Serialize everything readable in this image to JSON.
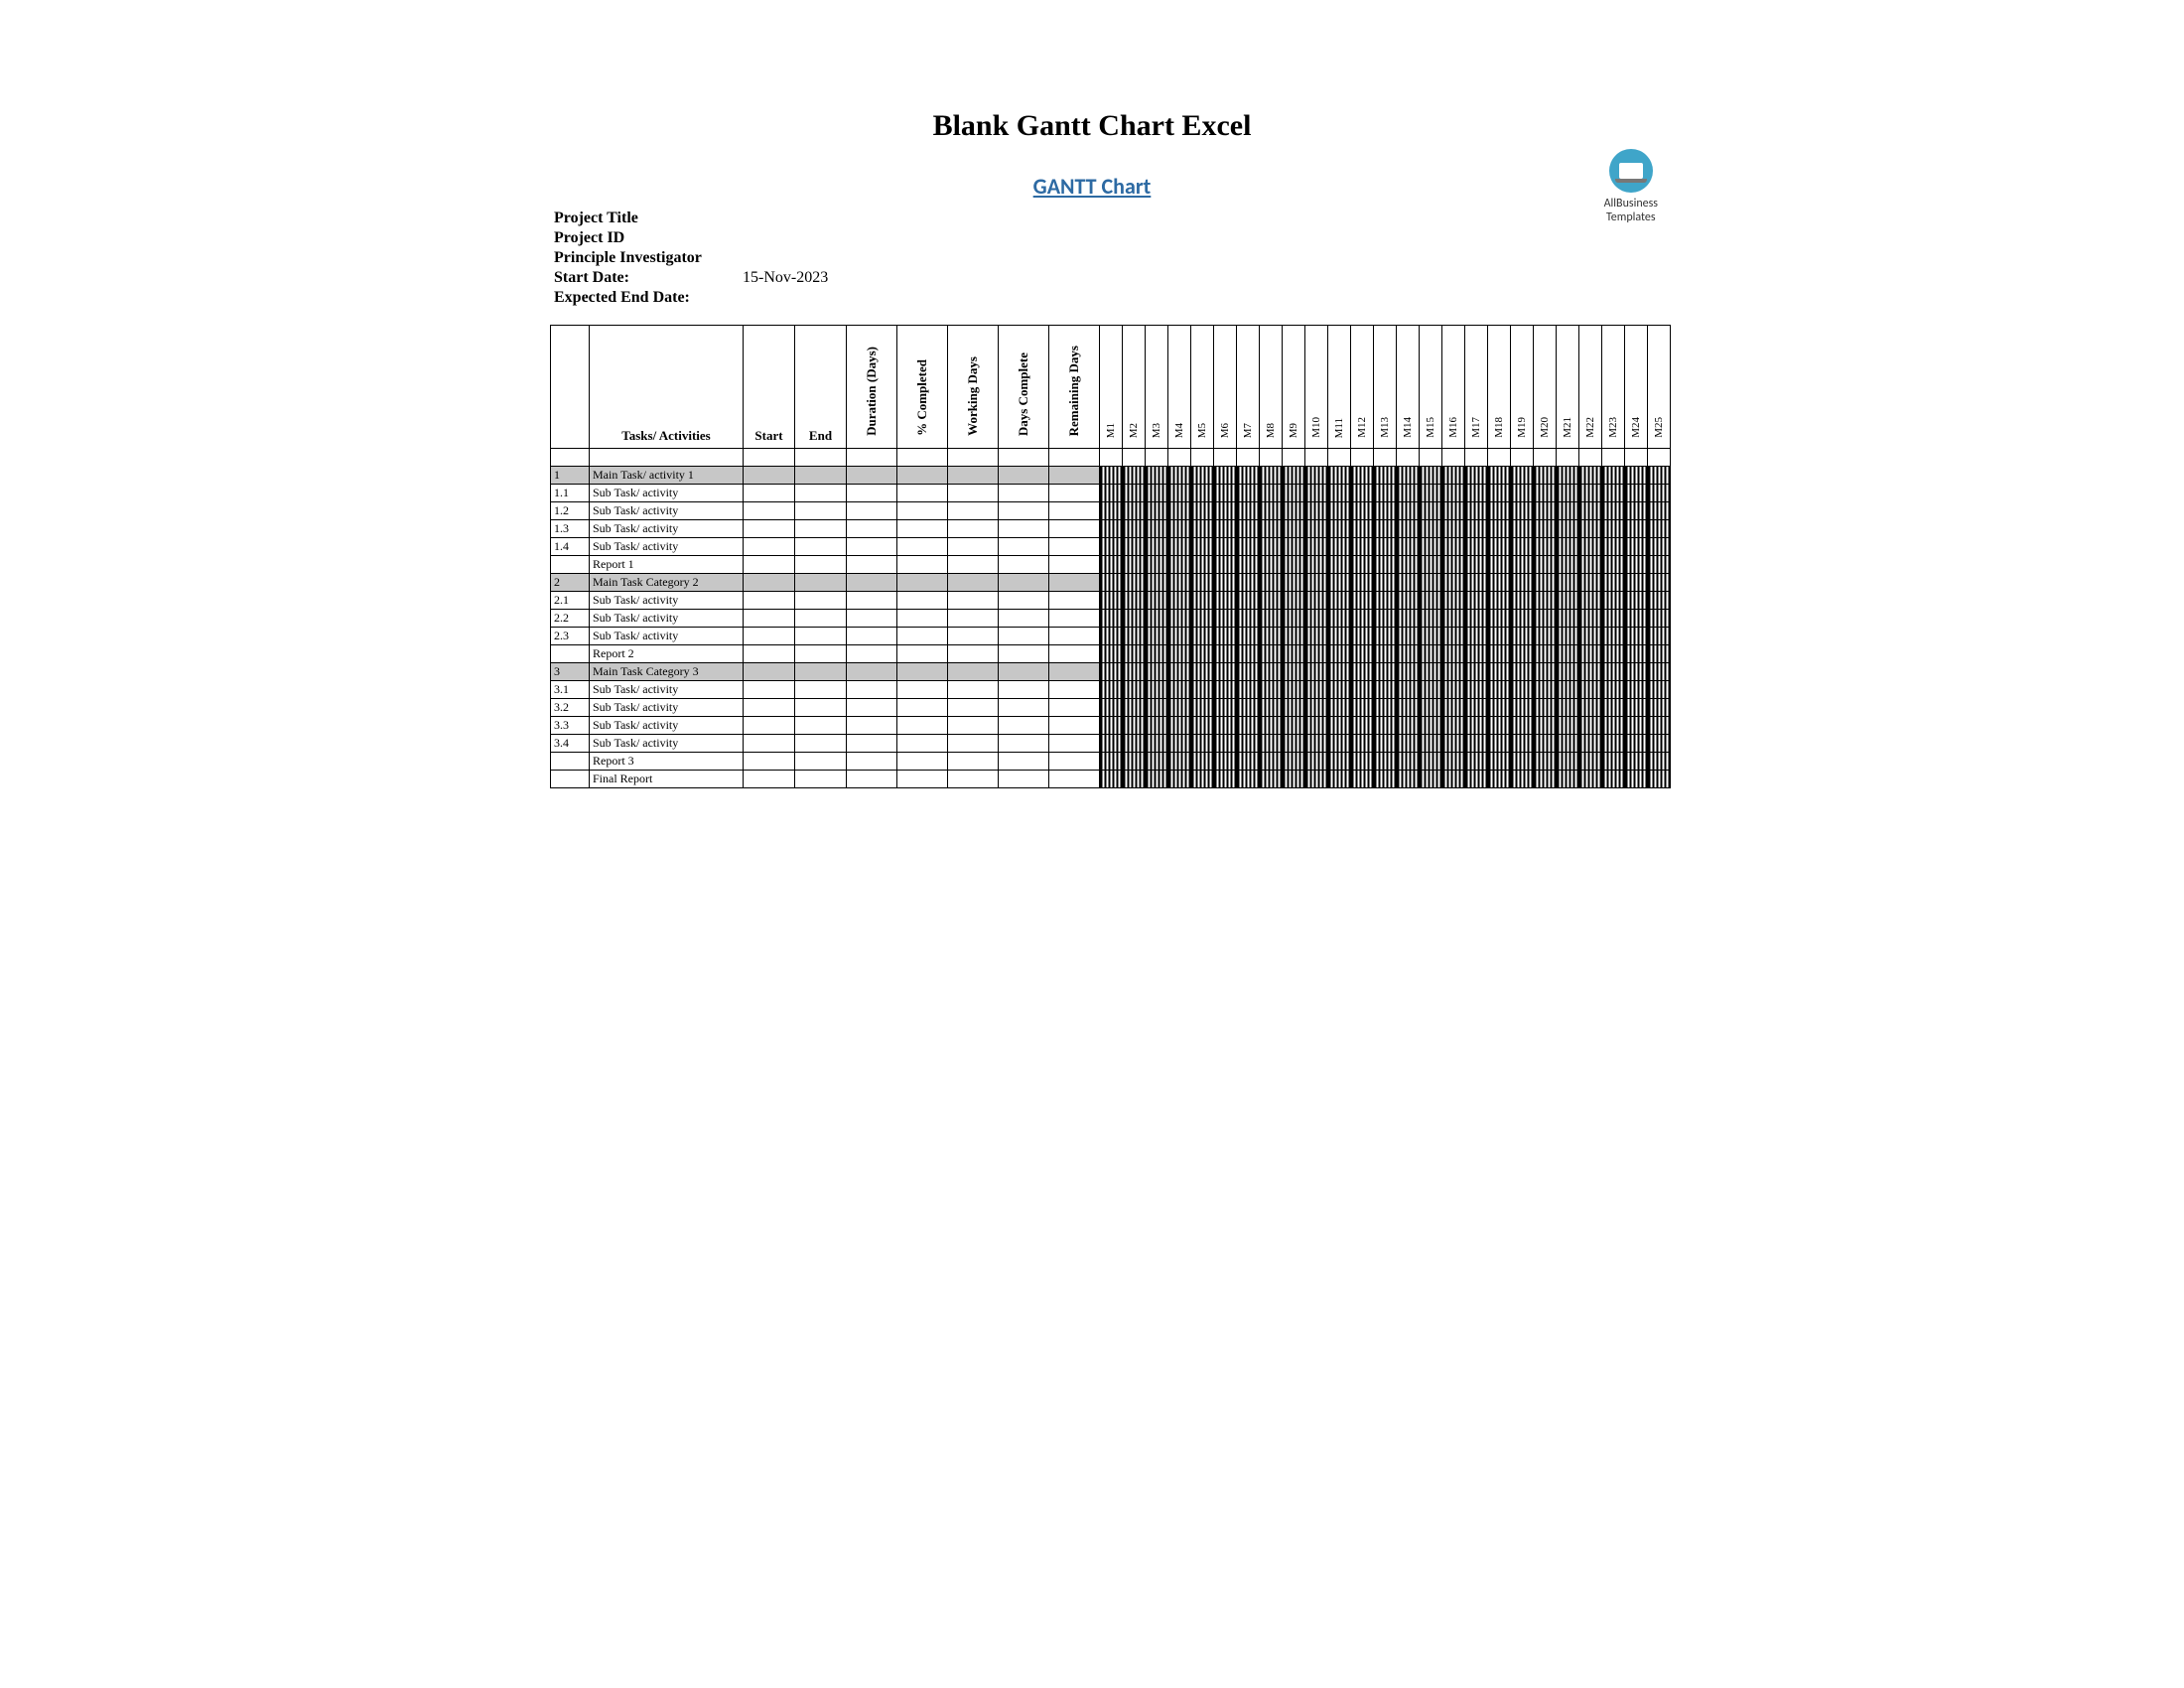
{
  "title": "Blank Gantt Chart Excel",
  "subtitle": "GANTT Chart",
  "logo": {
    "line1": "AllBusiness",
    "line2": "Templates"
  },
  "meta": {
    "project_title_label": "Project Title",
    "project_id_label": "Project ID",
    "pi_label": "Principle Investigator",
    "start_date_label": "Start Date:",
    "start_date_value": "15-Nov-2023",
    "end_date_label": "Expected End Date:"
  },
  "columns": {
    "id": "",
    "tasks": "Tasks/ Activities",
    "start": "Start",
    "end": "End",
    "duration": "Duration (Days)",
    "pct": "% Completed",
    "working": "Working Days",
    "days_complete": "Days Complete",
    "remaining": "Remaining Days"
  },
  "months": [
    "M1",
    "M2",
    "M3",
    "M4",
    "M5",
    "M6",
    "M7",
    "M8",
    "M9",
    "M10",
    "M11",
    "M12",
    "M13",
    "M14",
    "M15",
    "M16",
    "M17",
    "M18",
    "M19",
    "M20",
    "M21",
    "M22",
    "M23",
    "M24",
    "M25"
  ],
  "rows": [
    {
      "type": "spacer"
    },
    {
      "id": "1",
      "task": "Main Task/ activity 1",
      "shade": true
    },
    {
      "id": "1.1",
      "task": "Sub Task/ activity"
    },
    {
      "id": "1.2",
      "task": "Sub Task/ activity"
    },
    {
      "id": "1.3",
      "task": "Sub Task/ activity"
    },
    {
      "id": "1.4",
      "task": "Sub Task/ activity"
    },
    {
      "id": "",
      "task": "Report 1"
    },
    {
      "id": "2",
      "task": "Main Task Category 2",
      "shade": true
    },
    {
      "id": "2.1",
      "task": "Sub Task/ activity"
    },
    {
      "id": "2.2",
      "task": "Sub Task/ activity"
    },
    {
      "id": "2.3",
      "task": "Sub Task/ activity"
    },
    {
      "id": "",
      "task": "Report 2"
    },
    {
      "id": "3",
      "task": "Main Task Category 3",
      "shade": true
    },
    {
      "id": "3.1",
      "task": "Sub Task/ activity"
    },
    {
      "id": "3.2",
      "task": "Sub Task/ activity"
    },
    {
      "id": "3.3",
      "task": "Sub Task/ activity"
    },
    {
      "id": "3.4",
      "task": "Sub Task/ activity"
    },
    {
      "id": "",
      "task": "Report 3"
    },
    {
      "id": "",
      "task": "Final Report"
    }
  ],
  "chart_data": {
    "type": "table",
    "title": "GANTT Chart",
    "columns": [
      "Tasks/ Activities",
      "Start",
      "End",
      "Duration (Days)",
      "% Completed",
      "Working Days",
      "Days Complete",
      "Remaining Days"
    ],
    "timeline_columns": [
      "M1",
      "M2",
      "M3",
      "M4",
      "M5",
      "M6",
      "M7",
      "M8",
      "M9",
      "M10",
      "M11",
      "M12",
      "M13",
      "M14",
      "M15",
      "M16",
      "M17",
      "M18",
      "M19",
      "M20",
      "M21",
      "M22",
      "M23",
      "M24",
      "M25"
    ],
    "rows": [
      {
        "id": "1",
        "task": "Main Task/ activity 1",
        "start": null,
        "end": null,
        "duration": null,
        "pct_completed": null,
        "working_days": null,
        "days_complete": null,
        "remaining_days": null
      },
      {
        "id": "1.1",
        "task": "Sub Task/ activity",
        "start": null,
        "end": null,
        "duration": null,
        "pct_completed": null,
        "working_days": null,
        "days_complete": null,
        "remaining_days": null
      },
      {
        "id": "1.2",
        "task": "Sub Task/ activity",
        "start": null,
        "end": null,
        "duration": null,
        "pct_completed": null,
        "working_days": null,
        "days_complete": null,
        "remaining_days": null
      },
      {
        "id": "1.3",
        "task": "Sub Task/ activity",
        "start": null,
        "end": null,
        "duration": null,
        "pct_completed": null,
        "working_days": null,
        "days_complete": null,
        "remaining_days": null
      },
      {
        "id": "1.4",
        "task": "Sub Task/ activity",
        "start": null,
        "end": null,
        "duration": null,
        "pct_completed": null,
        "working_days": null,
        "days_complete": null,
        "remaining_days": null
      },
      {
        "id": "",
        "task": "Report 1",
        "start": null,
        "end": null,
        "duration": null,
        "pct_completed": null,
        "working_days": null,
        "days_complete": null,
        "remaining_days": null
      },
      {
        "id": "2",
        "task": "Main Task Category 2",
        "start": null,
        "end": null,
        "duration": null,
        "pct_completed": null,
        "working_days": null,
        "days_complete": null,
        "remaining_days": null
      },
      {
        "id": "2.1",
        "task": "Sub Task/ activity",
        "start": null,
        "end": null,
        "duration": null,
        "pct_completed": null,
        "working_days": null,
        "days_complete": null,
        "remaining_days": null
      },
      {
        "id": "2.2",
        "task": "Sub Task/ activity",
        "start": null,
        "end": null,
        "duration": null,
        "pct_completed": null,
        "working_days": null,
        "days_complete": null,
        "remaining_days": null
      },
      {
        "id": "2.3",
        "task": "Sub Task/ activity",
        "start": null,
        "end": null,
        "duration": null,
        "pct_completed": null,
        "working_days": null,
        "days_complete": null,
        "remaining_days": null
      },
      {
        "id": "",
        "task": "Report 2",
        "start": null,
        "end": null,
        "duration": null,
        "pct_completed": null,
        "working_days": null,
        "days_complete": null,
        "remaining_days": null
      },
      {
        "id": "3",
        "task": "Main Task Category 3",
        "start": null,
        "end": null,
        "duration": null,
        "pct_completed": null,
        "working_days": null,
        "days_complete": null,
        "remaining_days": null
      },
      {
        "id": "3.1",
        "task": "Sub Task/ activity",
        "start": null,
        "end": null,
        "duration": null,
        "pct_completed": null,
        "working_days": null,
        "days_complete": null,
        "remaining_days": null
      },
      {
        "id": "3.2",
        "task": "Sub Task/ activity",
        "start": null,
        "end": null,
        "duration": null,
        "pct_completed": null,
        "working_days": null,
        "days_complete": null,
        "remaining_days": null
      },
      {
        "id": "3.3",
        "task": "Sub Task/ activity",
        "start": null,
        "end": null,
        "duration": null,
        "pct_completed": null,
        "working_days": null,
        "days_complete": null,
        "remaining_days": null
      },
      {
        "id": "3.4",
        "task": "Sub Task/ activity",
        "start": null,
        "end": null,
        "duration": null,
        "pct_completed": null,
        "working_days": null,
        "days_complete": null,
        "remaining_days": null
      },
      {
        "id": "",
        "task": "Report 3",
        "start": null,
        "end": null,
        "duration": null,
        "pct_completed": null,
        "working_days": null,
        "days_complete": null,
        "remaining_days": null
      },
      {
        "id": "",
        "task": "Final Report",
        "start": null,
        "end": null,
        "duration": null,
        "pct_completed": null,
        "working_days": null,
        "days_complete": null,
        "remaining_days": null
      }
    ]
  }
}
